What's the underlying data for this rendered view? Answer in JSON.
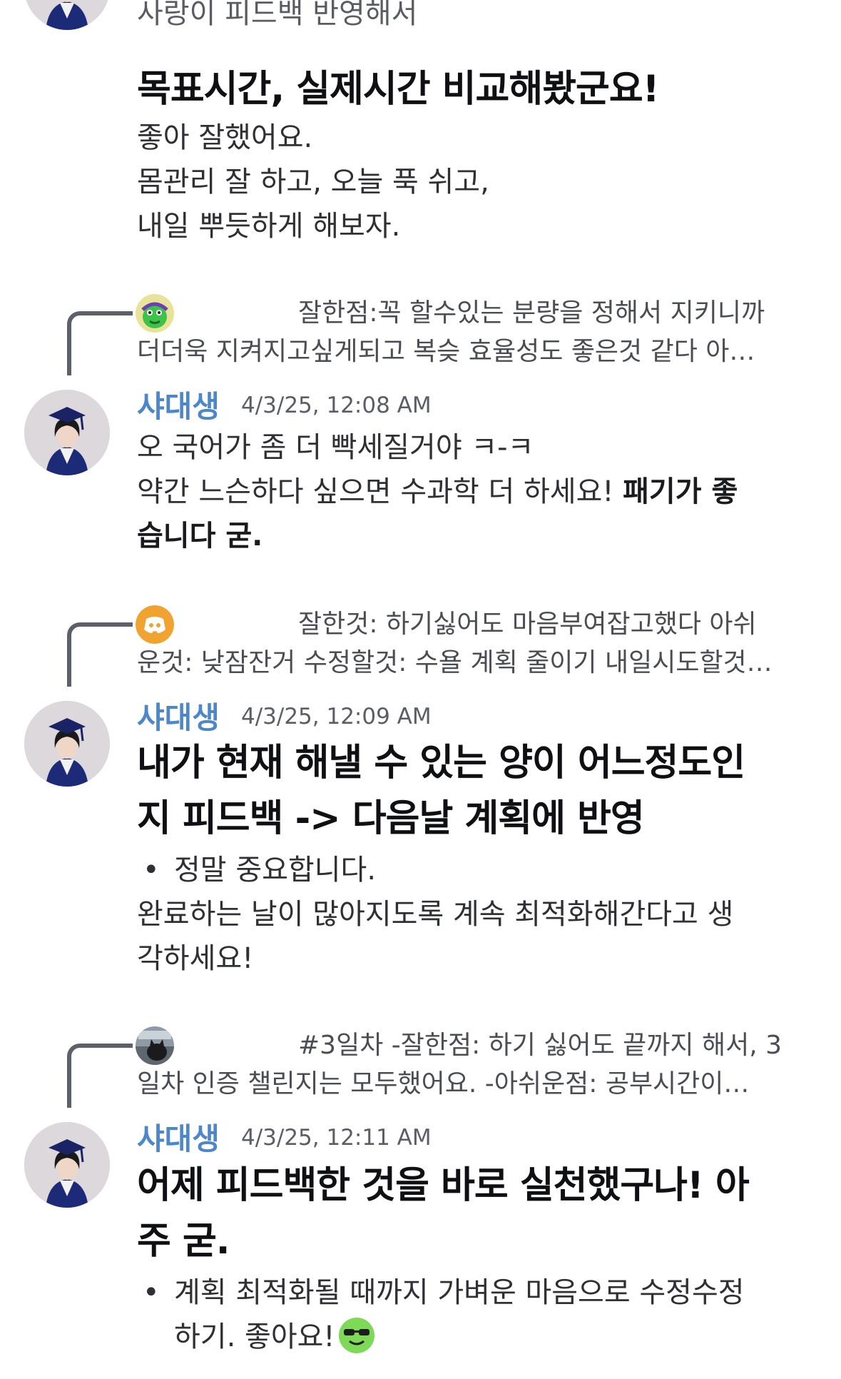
{
  "message_top": {
    "partial_line": "사랑이 피드백 반영해서",
    "heading": "목표시간, 실제시간 비교해봤군요!",
    "lines": [
      "좋아 잘했어요.",
      "몸관리 잘 하고, 오늘 푹 쉬고,",
      "내일 뿌듯하게 해보자."
    ]
  },
  "messages": [
    {
      "reply_preview": {
        "line1": "잘한점:꼭 할수있는 분량을 정해서 지키니까",
        "line2": "더더욱 지켜지고싶게되고 복슺 효율성도 좋은것 같다 아…"
      },
      "username": "샤대생",
      "timestamp": "4/3/25, 12:08 AM",
      "line1": "오 국어가 좀 더 빡세질거야 ㅋ-ㅋ",
      "line2_plain": "약간 느슨하다 싶으면 수과학 더 하세요! ",
      "line2_bold": "패기가 좋",
      "line3_bold": "습니다 굳."
    },
    {
      "reply_preview": {
        "line1": "잘한것: 하기싫어도 마음부여잡고했다 아쉬",
        "line2": "운것: 낮잠잔거 수정할것: 수욜 계획 줄이기 내일시도할것…"
      },
      "username": "샤대생",
      "timestamp": "4/3/25, 12:09 AM",
      "heading_line1": "내가 현재 해낼 수 있는 양이 어느정도인",
      "heading_line2": "지 피드백 -> 다음날 계획에 반영",
      "bullet": "정말 중요합니다.",
      "line1": "완료하는 날이 많아지도록 계속 최적화해간다고 생",
      "line2": "각하세요!"
    },
    {
      "reply_preview": {
        "line1": "#3일차 -잘한점: 하기 싫어도 끝까지 해서, 3",
        "line2": "일차 인증 챌린지는 모두했어요.  -아쉬운점: 공부시간이…"
      },
      "username": "샤대생",
      "timestamp": "4/3/25, 12:11 AM",
      "heading_line1": "어제 피드백한 것을 바로 실천했구나! 아",
      "heading_line2": "주 굳.",
      "bullet_line1": "계획 최적화될 때까지 가벼운 마음으로 수정수정",
      "bullet_line2": "하기. 좋아요!"
    }
  ],
  "colors": {
    "username": "#4b87c9",
    "text": "#2f3035",
    "muted": "#4b4d54",
    "discord_orange": "#f0a330"
  },
  "icons": {
    "reply1": "green-character-icon",
    "reply2": "discord-logo-icon",
    "reply3": "cat-photo-icon",
    "emoji": "sunglasses-face-icon"
  }
}
